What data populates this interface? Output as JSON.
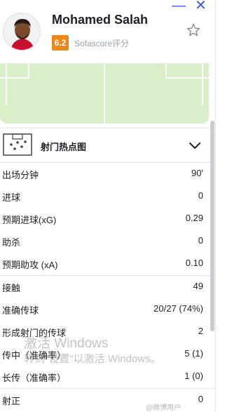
{
  "player": {
    "name": "Mohamed Salah",
    "rating": "6.2",
    "rating_source": "Sofascore评分"
  },
  "heatmap": {
    "label": "射门热点图"
  },
  "stats": [
    {
      "label": "出场分钟",
      "value": "90'"
    },
    {
      "label": "进球",
      "value": "0"
    },
    {
      "label": "预期进球(xG)",
      "value": "0.29"
    },
    {
      "label": "助杀",
      "value": "0"
    },
    {
      "label": "预期助攻 (xA)",
      "value": "0.10"
    },
    {
      "label": "接触",
      "value": "49"
    },
    {
      "label": "准确传球",
      "value": "20/27 (74%)"
    },
    {
      "label": "形成射门的传球",
      "value": "2"
    },
    {
      "label": "传中（准确率）",
      "value": "5 (1)"
    },
    {
      "label": "长传（准确率）",
      "value": "1 (0)"
    },
    {
      "label": "射正",
      "value": "0"
    }
  ],
  "watermark": {
    "line1": "激活 Windows",
    "line2": "转到\"设置\"以激活 Windows。",
    "source": "@微博用户"
  },
  "colors": {
    "rating_badge": "#e8891b",
    "pitch": "#d8efc9",
    "accent_window_controls": "#3b5bdb"
  }
}
